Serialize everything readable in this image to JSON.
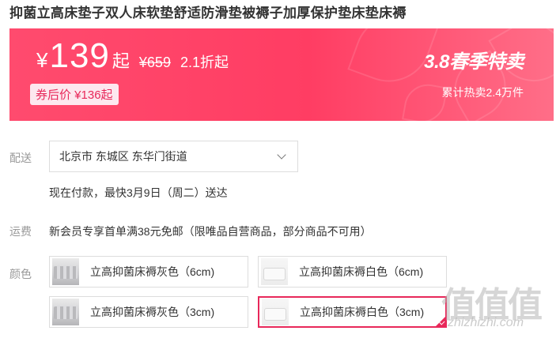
{
  "product": {
    "title": "抑菌立高床垫子双人床软垫舒适防滑垫被褥子加厚保护垫床垫床褥"
  },
  "price": {
    "currency": "¥",
    "value": "139",
    "suffix": "起",
    "original": "¥659",
    "discount": "2.1折起",
    "coupon": "券后价 ¥136起",
    "promo_title": "3.8春季特卖",
    "promo_sub": "累计热卖2.4万件",
    "banner_color": "#ff4b6e"
  },
  "delivery": {
    "label": "配送",
    "address": "北京市 东城区 东华门街道",
    "estimate": "现在付款，最快3月9日（周二）送达"
  },
  "shipping": {
    "label": "运费",
    "text": "新会员专享首单满38元免邮（限唯品自营商品，部分商品不可用）"
  },
  "color": {
    "label": "颜色",
    "options": [
      {
        "label": "立高抑菌床褥灰色（6cm)",
        "thumb": "gray",
        "selected": false
      },
      {
        "label": "立高抑菌床褥白色（6cm)",
        "thumb": "white",
        "selected": false
      },
      {
        "label": "立高抑菌床褥灰色（3cm)",
        "thumb": "gray",
        "selected": false
      },
      {
        "label": "立高抑菌床褥白色（3cm)",
        "thumb": "white",
        "selected": true
      }
    ],
    "accent": "#e8285a"
  },
  "watermark": {
    "glyphs": "值值值",
    "text": "zhizhizhi.com"
  }
}
